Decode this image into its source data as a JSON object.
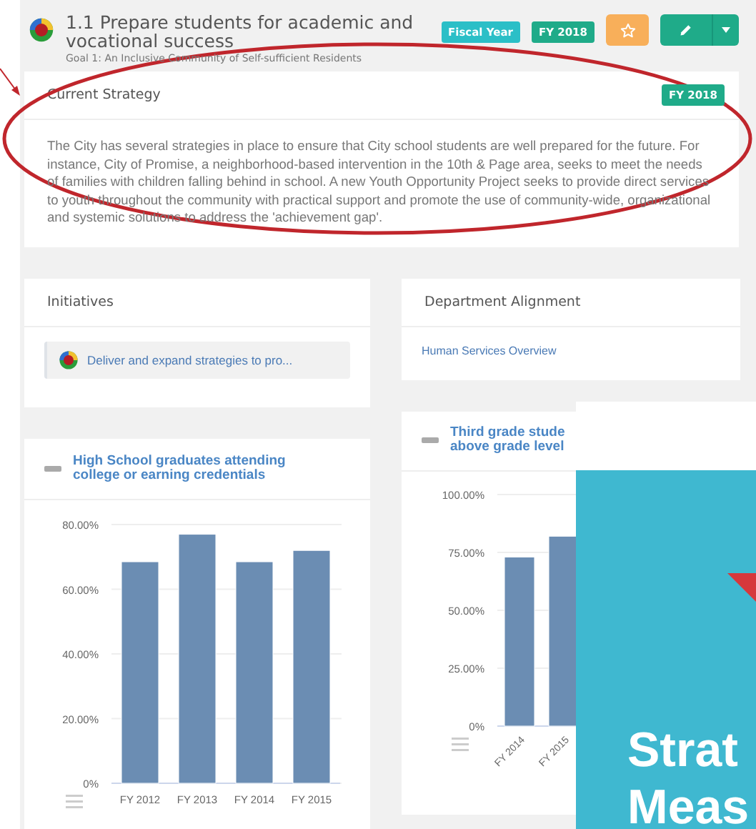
{
  "header": {
    "title": "1.1 Prepare students for academic and vocational success",
    "subtitle": "Goal 1: An Inclusive Community of Self-sufficient Residents",
    "badges": [
      {
        "label": "Fiscal Year",
        "color": "#2bbfc7"
      },
      {
        "label": "FY 2018",
        "color": "#1fab89"
      }
    ]
  },
  "strategy": {
    "title": "Current Strategy",
    "badge": "FY 2018",
    "text": "The City has several strategies in place to ensure that City school students are well prepared for the future.  For instance, City of Promise, a neighborhood-based intervention in the 10th & Page area, seeks to meet the needs of families with children falling behind in school. A new Youth Opportunity Project seeks to provide direct services to youth throughout the community with practical support and promote the use of community-wide, organizational and systemic solutions to address the 'achievement gap'."
  },
  "initiatives": {
    "title": "Initiatives",
    "items": [
      {
        "label": "Deliver and expand strategies to pro..."
      }
    ]
  },
  "department_alignment": {
    "title": "Department Alignment",
    "links": [
      "Human Services Overview"
    ]
  },
  "measures": [
    {
      "title_lines": [
        "High School graduates attending",
        "college or earning credentials"
      ],
      "chart_data": {
        "type": "bar",
        "grid": true,
        "categories": [
          "FY 2012",
          "FY 2013",
          "FY 2014",
          "FY 2015"
        ],
        "series": [
          {
            "color": "#6b8db3",
            "values": [
              68.5,
              77,
              68.5,
              72
            ]
          }
        ],
        "ylim": [
          0,
          80
        ],
        "yticks": [
          {
            "value": 0,
            "label": "0%"
          },
          {
            "value": 20,
            "label": "20.00%"
          },
          {
            "value": 40,
            "label": "40.00%"
          },
          {
            "value": 60,
            "label": "60.00%"
          },
          {
            "value": 80,
            "label": "80.00%"
          }
        ]
      }
    },
    {
      "title_lines": [
        "Third grade stude",
        "above grade level"
      ],
      "chart_data": {
        "type": "bar",
        "grid": true,
        "categories": [
          "FY 2014",
          "FY 2015"
        ],
        "series": [
          {
            "color": "#6b8db3",
            "values": [
              73,
              82
            ]
          }
        ],
        "ylim": [
          0,
          100
        ],
        "yticks": [
          {
            "value": 0,
            "label": "0%"
          },
          {
            "value": 25,
            "label": "25.00%"
          },
          {
            "value": 50,
            "label": "50.00%"
          },
          {
            "value": 75,
            "label": "75.00%"
          },
          {
            "value": 100,
            "label": "100.00%"
          }
        ]
      }
    }
  ],
  "overlay": {
    "lines": [
      "Strat",
      "Meas"
    ]
  }
}
